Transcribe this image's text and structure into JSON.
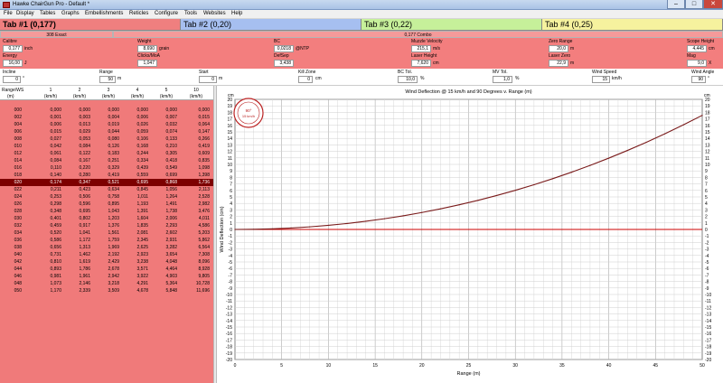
{
  "window": {
    "title": "Hawke ChairGun Pro - Default *",
    "buttons": [
      "–",
      "□",
      "✕"
    ]
  },
  "menu": [
    "File",
    "Display",
    "Tables",
    "Graphs",
    "Embellishments",
    "Reticles",
    "Configure",
    "Tools",
    "Websites",
    "Help"
  ],
  "tabs": [
    {
      "label": "Tab #1 (0,177)",
      "color": "#ef7f7f"
    },
    {
      "label": "Tab #2 (0,20)",
      "color": "#a6bff0"
    },
    {
      "label": "Tab #3 (0,22)",
      "color": "#c6f09a"
    },
    {
      "label": "Tab #4 (0,25)",
      "color": "#f6f29e"
    }
  ],
  "strip": {
    "left": "308 Exact",
    "right": "0,177 Combo"
  },
  "fields": {
    "calibre": {
      "label": "Calibre",
      "value": "0,177",
      "unit": "inch"
    },
    "energy": {
      "label": "Energy",
      "value": "16,00",
      "unit": "J"
    },
    "weight": {
      "label": "Weight",
      "value": "8,690",
      "unit": "grain"
    },
    "clicks_moa": {
      "label": "Clicks/MoA",
      "value": "1,047"
    },
    "bc": {
      "label": "BC",
      "value": "0,0218",
      "unit": "@NTP"
    },
    "sd": {
      "label": "DefSep",
      "value": "3,438"
    },
    "muzzle_velocity": {
      "label": "Muzzle Velocity",
      "value": "215,1",
      "unit": "m/s"
    },
    "laser_height": {
      "label": "Laser Height",
      "value": "7,620",
      "unit": "cm"
    },
    "zero_range": {
      "label": "Zero Range",
      "value": "20,0",
      "unit": "m"
    },
    "laser_zero": {
      "label": "Laser Zero",
      "value": "22,9",
      "unit": "m"
    },
    "scope_height": {
      "label": "Scope Height",
      "value": "4,445",
      "unit": "cm"
    },
    "mag": {
      "label": "Mag",
      "value": "9,0",
      "unit": "X"
    },
    "incline": {
      "label": "Incline",
      "value": "0",
      "unit": "°"
    },
    "range": {
      "label": "Range",
      "value": "50",
      "unit": "m"
    },
    "start": {
      "label": "Start",
      "value": "0",
      "unit": "m"
    },
    "kill_zone": {
      "label": "Kill Zone",
      "value": "0",
      "unit": "cm"
    },
    "bc_tol": {
      "label": "BC Tol.",
      "value": "10,0",
      "unit": "%"
    },
    "mv_tol": {
      "label": "MV Tol.",
      "value": "1,0",
      "unit": "%"
    },
    "wind_speed": {
      "label": "Wind Speed",
      "value": "15",
      "unit": "km/h"
    },
    "wind_angle": {
      "label": "Wind Angle",
      "value": "90",
      "unit": "°"
    }
  },
  "table": {
    "headers": [
      "Range\\WS",
      "1",
      "2",
      "3",
      "4",
      "5",
      "10"
    ],
    "units": [
      "(m)",
      "(km/h)",
      "(km/h)",
      "(km/h)",
      "(km/h)",
      "(km/h)",
      "(km/h)"
    ],
    "selected_row": 10,
    "rows": [
      [
        "000",
        "0,000",
        "0,000",
        "0,000",
        "0,000",
        "0,000",
        "0,000"
      ],
      [
        "002",
        "0,001",
        "0,003",
        "0,004",
        "0,006",
        "0,007",
        "0,015"
      ],
      [
        "004",
        "0,006",
        "0,013",
        "0,019",
        "0,026",
        "0,032",
        "0,064"
      ],
      [
        "006",
        "0,015",
        "0,029",
        "0,044",
        "0,059",
        "0,074",
        "0,147"
      ],
      [
        "008",
        "0,027",
        "0,053",
        "0,080",
        "0,106",
        "0,133",
        "0,266"
      ],
      [
        "010",
        "0,042",
        "0,084",
        "0,126",
        "0,168",
        "0,210",
        "0,419"
      ],
      [
        "012",
        "0,061",
        "0,122",
        "0,183",
        "0,244",
        "0,305",
        "0,609"
      ],
      [
        "014",
        "0,084",
        "0,167",
        "0,251",
        "0,334",
        "0,418",
        "0,835"
      ],
      [
        "016",
        "0,110",
        "0,220",
        "0,329",
        "0,439",
        "0,549",
        "1,098"
      ],
      [
        "018",
        "0,140",
        "0,280",
        "0,419",
        "0,559",
        "0,699",
        "1,398"
      ],
      [
        "020",
        "0,174",
        "0,347",
        "0,521",
        "0,695",
        "0,868",
        "1,736"
      ],
      [
        "022",
        "0,211",
        "0,423",
        "0,634",
        "0,845",
        "1,056",
        "2,113"
      ],
      [
        "024",
        "0,253",
        "0,506",
        "0,758",
        "1,011",
        "1,264",
        "2,528"
      ],
      [
        "026",
        "0,298",
        "0,596",
        "0,895",
        "1,193",
        "1,491",
        "2,982"
      ],
      [
        "028",
        "0,348",
        "0,695",
        "1,043",
        "1,391",
        "1,738",
        "3,476"
      ],
      [
        "030",
        "0,401",
        "0,802",
        "1,203",
        "1,604",
        "2,006",
        "4,011"
      ],
      [
        "032",
        "0,459",
        "0,917",
        "1,376",
        "1,835",
        "2,293",
        "4,586"
      ],
      [
        "034",
        "0,520",
        "1,041",
        "1,561",
        "2,081",
        "2,602",
        "5,203"
      ],
      [
        "036",
        "0,586",
        "1,172",
        "1,759",
        "2,345",
        "2,931",
        "5,862"
      ],
      [
        "038",
        "0,656",
        "1,313",
        "1,969",
        "2,625",
        "3,282",
        "6,564"
      ],
      [
        "040",
        "0,731",
        "1,462",
        "2,192",
        "2,923",
        "3,654",
        "7,308"
      ],
      [
        "042",
        "0,810",
        "1,619",
        "2,429",
        "3,238",
        "4,048",
        "8,096"
      ],
      [
        "044",
        "0,893",
        "1,786",
        "2,678",
        "3,571",
        "4,464",
        "8,928"
      ],
      [
        "046",
        "0,981",
        "1,961",
        "2,942",
        "3,922",
        "4,903",
        "9,805"
      ],
      [
        "048",
        "1,073",
        "2,146",
        "3,218",
        "4,291",
        "5,364",
        "10,728"
      ],
      [
        "050",
        "1,170",
        "2,339",
        "3,509",
        "4,678",
        "5,848",
        "11,696"
      ]
    ]
  },
  "chart_data": {
    "type": "line",
    "title": "Wind Deflection @ 15 km/h and 90 Degrees v. Range (m)",
    "xlabel": "Range (m)",
    "ylabel": "Wind Deflection (cm)",
    "y_unit_label": "cm",
    "xlim": [
      0,
      50
    ],
    "ylim": [
      -20,
      20
    ],
    "xticks": [
      0,
      5,
      10,
      15,
      20,
      25,
      30,
      35,
      40,
      45,
      50
    ],
    "yticks": [
      -20,
      -19,
      -18,
      -17,
      -16,
      -15,
      -14,
      -13,
      -12,
      -11,
      -10,
      -9,
      -8,
      -7,
      -6,
      -5,
      -4,
      -3,
      -2,
      -1,
      0,
      1,
      2,
      3,
      4,
      5,
      6,
      7,
      8,
      9,
      10,
      11,
      12,
      13,
      14,
      15,
      16,
      17,
      18,
      19,
      20
    ],
    "grid": true,
    "zero_line_color": "#cc0000",
    "series": [
      {
        "color": "#7a1b1b",
        "x": [
          0,
          2,
          4,
          6,
          8,
          10,
          12,
          14,
          16,
          18,
          20,
          22,
          24,
          26,
          28,
          30,
          32,
          34,
          36,
          38,
          40,
          42,
          44,
          46,
          48,
          50
        ],
        "y": [
          0,
          0.022,
          0.096,
          0.221,
          0.399,
          0.629,
          0.914,
          1.253,
          1.647,
          2.097,
          2.604,
          3.17,
          3.792,
          4.473,
          5.214,
          6.017,
          6.879,
          7.805,
          8.793,
          9.846,
          10.962,
          12.144,
          13.392,
          14.708,
          16.092,
          17.544
        ]
      }
    ],
    "inset": {
      "angle_label": "90°",
      "speed_label": "15 km/h"
    }
  }
}
